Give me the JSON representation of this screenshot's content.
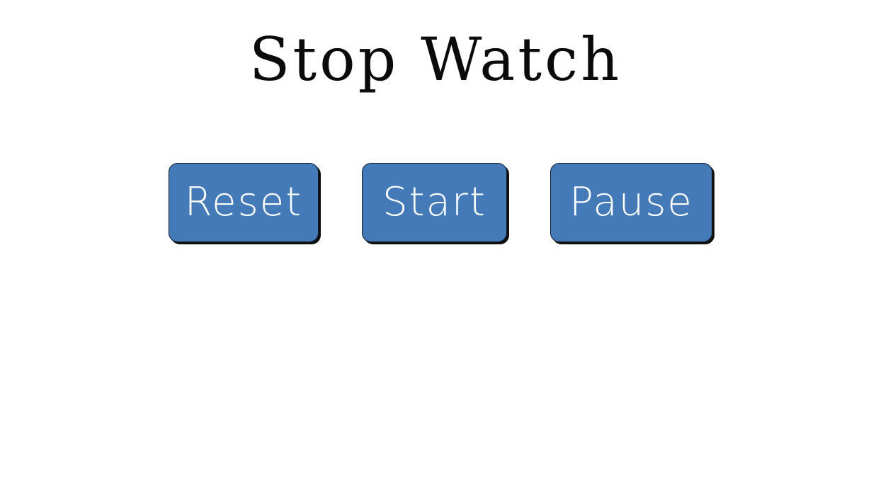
{
  "header": {
    "title": "Stop Watch"
  },
  "controls": {
    "reset_label": "Reset",
    "start_label": "Start",
    "pause_label": "Pause"
  },
  "colors": {
    "button_background": "#457ab9",
    "button_text": "#ffffff",
    "title_text": "#0b0b0b",
    "page_background": "#ffffff"
  }
}
